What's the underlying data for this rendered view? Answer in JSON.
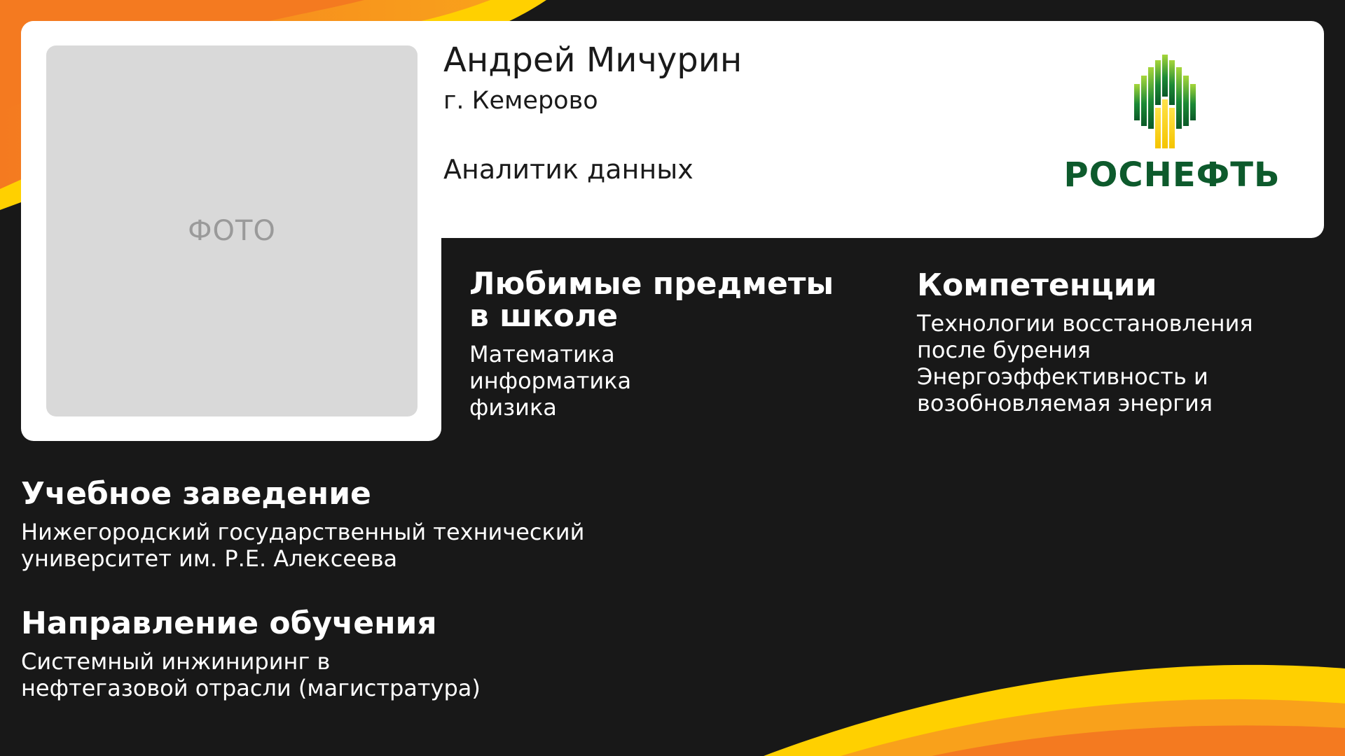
{
  "profile": {
    "photo_placeholder": "ФОТО",
    "name": "Андрей Мичурин",
    "city": "г. Кемерово",
    "role": "Аналитик данных"
  },
  "logo": {
    "text": "РОСНЕФТЬ",
    "text_color": "#0d5a2c",
    "bar_colors": [
      "#0b6b2e",
      "#7dc22a",
      "#ffd400"
    ]
  },
  "favorite_subjects": {
    "title_lines": [
      "Любимые предметы",
      "в школе"
    ],
    "items": [
      "Математика",
      "информатика",
      "физика"
    ]
  },
  "competences": {
    "title": "Компетенции",
    "lines": [
      "Технологии восстановления",
      "после бурения",
      "Энергоэффективность и",
      "возобновляемая энергия"
    ]
  },
  "university": {
    "title": "Учебное заведение",
    "lines": [
      "Нижегородский государственный технический",
      "университет им. Р.Е. Алексеева"
    ]
  },
  "direction": {
    "title": "Направление обучения",
    "lines": [
      "Системный инжиниринг в",
      "нефтегазовой отрасли (магистратура)"
    ]
  },
  "theme": {
    "background": "#181818",
    "card": "#ffffff",
    "accent_orange": "#f47a20",
    "accent_yellow": "#ffd000"
  }
}
